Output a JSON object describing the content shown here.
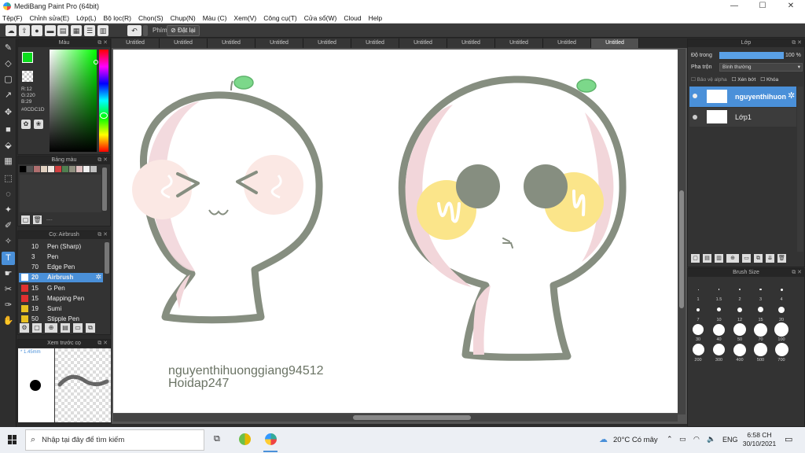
{
  "window": {
    "title": "MediBang Paint Pro (64bit)",
    "min": "—",
    "max": "☐",
    "close": "✕"
  },
  "menu": [
    "Tệp(F)",
    "Chỉnh sửa(E)",
    "Lớp(L)",
    "Bộ lọc(R)",
    "Chọn(S)",
    "Chụp(N)",
    "Màu (C)",
    "Xem(V)",
    "Công cụ(T)",
    "Cửa sổ(W)",
    "Cloud",
    "Help"
  ],
  "toolbar": {
    "key_label": "Phím",
    "reset_label": "Đặt lại"
  },
  "tabs": [
    "Untitled",
    "Untitled",
    "Untitled",
    "Untitled",
    "Untitled",
    "Untitled",
    "Untitled",
    "Untitled",
    "Untitled",
    "Untitled",
    "Untitled"
  ],
  "color_panel": {
    "title": "Màu",
    "r": "R:12",
    "g": "G:220",
    "b": "B:29",
    "hex": "#0CDC1D",
    "fg_color": "#0cdc1d"
  },
  "palette_panel": {
    "title": "Bảng màu",
    "swatches": [
      "#000000",
      "#555555",
      "#b07070",
      "#e0d0c0",
      "#f0e8e0",
      "#d04040",
      "#508050",
      "#909080",
      "#e0c0c0",
      "#f0f0f0",
      "#c0c0c0"
    ],
    "more": "...."
  },
  "brush_list": {
    "title": "Cọ: Airbrush",
    "items": [
      {
        "size": "10",
        "name": "Pen (Sharp)",
        "color": "#333333"
      },
      {
        "size": "3",
        "name": "Pen",
        "color": "#333333"
      },
      {
        "size": "70",
        "name": "Edge Pen",
        "color": "#333333"
      },
      {
        "size": "20",
        "name": "Airbrush",
        "color": "#ffffff"
      },
      {
        "size": "15",
        "name": "G Pen",
        "color": "#e03030"
      },
      {
        "size": "15",
        "name": "Mapping Pen",
        "color": "#e03030"
      },
      {
        "size": "19",
        "name": "Sumi",
        "color": "#e8c020"
      },
      {
        "size": "50",
        "name": "Stipple Pen",
        "color": "#e8c020"
      }
    ]
  },
  "preview_panel": {
    "title": "Xem trước cọ",
    "size": "* 1.45mm"
  },
  "layer_panel": {
    "title": "Lớp",
    "opacity_label": "Độ trong",
    "opacity_value": "100 %",
    "opacity": 1.0,
    "blend_label": "Pha trộn",
    "blend_value": "Bình thường",
    "protect_alpha": "Bảo vệ alpha",
    "clipping": "Xén bớt",
    "lock": "Khóa",
    "layers": [
      {
        "name": "nguyenthihuon"
      },
      {
        "name": "Lớp1"
      }
    ]
  },
  "brush_size_panel": {
    "title": "Brush Size",
    "sizes": [
      "1",
      "1.5",
      "2",
      "3",
      "4",
      "7",
      "10",
      "12",
      "15",
      "20",
      "30",
      "40",
      "50",
      "70",
      "100",
      "200",
      "300",
      "400",
      "500",
      "700"
    ]
  },
  "canvas": {
    "watermark_line1": "nguyenthihuonggiang94512",
    "watermark_line2": "Hoidap247"
  },
  "taskbar": {
    "search_placeholder": "Nhập tại đây để tìm kiếm",
    "weather": "20°C Có mây",
    "lang": "ENG",
    "time": "6:58 CH",
    "date": "30/10/2021"
  }
}
